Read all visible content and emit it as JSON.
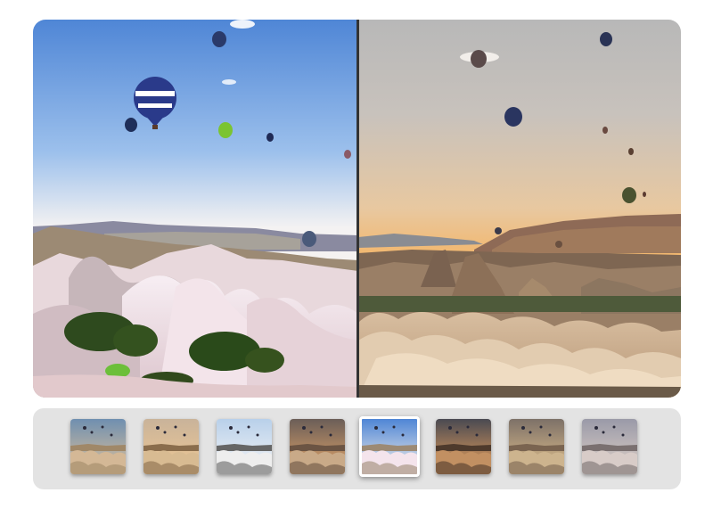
{
  "comparison": {
    "original_label": "",
    "filtered_label": ""
  },
  "filters": [
    {
      "name": "filter-1",
      "sky_top": "#6f8fb0",
      "sky_bottom": "#e2c39a",
      "ground": "#a08868",
      "rock": "#d4b896"
    },
    {
      "name": "filter-2",
      "sky_top": "#c9b39a",
      "sky_bottom": "#f0c994",
      "ground": "#8a6d4c",
      "rock": "#d8bb92"
    },
    {
      "name": "filter-3",
      "sky_top": "#b8d0ea",
      "sky_bottom": "#f6f6f6",
      "ground": "#666666",
      "rock": "#eeeeee"
    },
    {
      "name": "filter-4",
      "sky_top": "#6b5e58",
      "sky_bottom": "#e8a86a",
      "ground": "#6b5443",
      "rock": "#c9aa88"
    },
    {
      "name": "filter-5",
      "sky_top": "#4f86d6",
      "sky_bottom": "#fbf4ea",
      "ground": "#9c8a74",
      "rock": "#f4e4ec",
      "selected": true
    },
    {
      "name": "filter-6",
      "sky_top": "#4a4a52",
      "sky_bottom": "#f0a45c",
      "ground": "#4e3a2c",
      "rock": "#c29062"
    },
    {
      "name": "filter-7",
      "sky_top": "#7d7168",
      "sky_bottom": "#e6c48e",
      "ground": "#7a6450",
      "rock": "#cdb48e"
    },
    {
      "name": "filter-8",
      "sky_top": "#9a9aa8",
      "sky_bottom": "#e0d2c8",
      "ground": "#7a7070",
      "rock": "#d8ccc8"
    }
  ]
}
